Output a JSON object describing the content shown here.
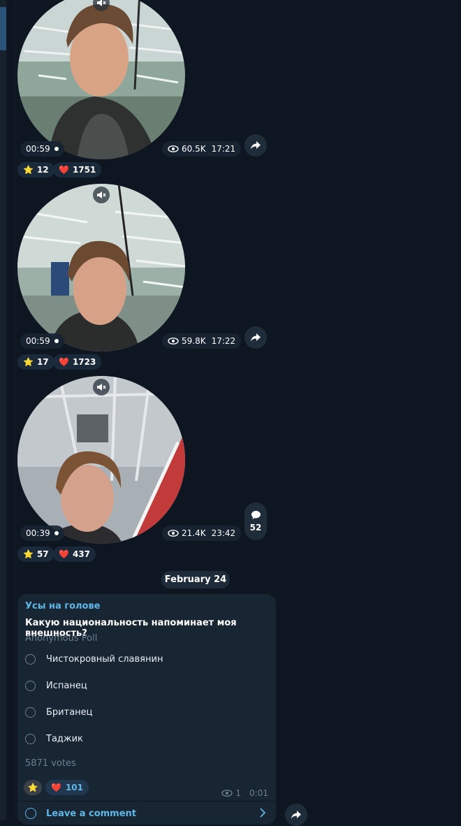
{
  "messages": [
    {
      "duration": "00:59",
      "views": "60.5K",
      "time": "17:21",
      "reactions": [
        {
          "emoji": "⭐",
          "count": "12"
        },
        {
          "emoji": "❤️",
          "count": "1751"
        }
      ]
    },
    {
      "duration": "00:59",
      "views": "59.8K",
      "time": "17:22",
      "reactions": [
        {
          "emoji": "⭐",
          "count": "17"
        },
        {
          "emoji": "❤️",
          "count": "1723"
        }
      ]
    },
    {
      "duration": "00:39",
      "views": "21.4K",
      "time": "23:42",
      "reactions": [
        {
          "emoji": "⭐",
          "count": "57"
        },
        {
          "emoji": "❤️",
          "count": "437"
        }
      ],
      "comments": "52"
    }
  ],
  "date_separator": "February 24",
  "poll": {
    "author": "Усы на голове",
    "question": "Какую национальность напоминает моя внешность?",
    "type": "Anonymous Poll",
    "options": [
      "Чистокровный славянин",
      "Испанец",
      "Британец",
      "Таджик"
    ],
    "votes": "5871 votes",
    "reactions": [
      {
        "emoji": "⭐",
        "count": ""
      },
      {
        "emoji": "❤️",
        "count": "101"
      }
    ],
    "views": "1",
    "time": "0:01",
    "leave_comment": "Leave a comment"
  },
  "colors": {
    "background": "#0e1621",
    "bubble": "#182533",
    "accent": "#5fb8e8"
  }
}
